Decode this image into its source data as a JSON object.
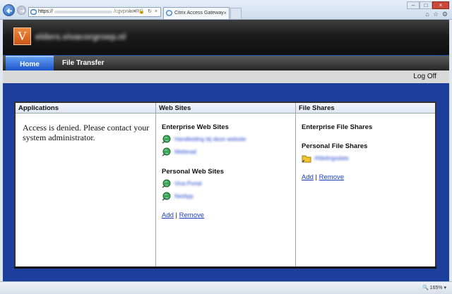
{
  "browser": {
    "url_scheme": "https://",
    "url_path": "/cgvpn/aHR0cDov",
    "tab_title": "Citrix Access Gateway",
    "address_buttons": "⌕ ▾ 🔒 ↻ ×",
    "window_buttons": {
      "minimize": "–",
      "maximize": "□",
      "close": "×"
    },
    "tool_icons": {
      "home": "⌂",
      "favorites": "☆",
      "settings": "⚙"
    },
    "tab_close": "×",
    "zoom": "🔍 165% ▾"
  },
  "site": {
    "logo_letter": "V",
    "title": "elders.vivacorgroep.nl"
  },
  "menu": {
    "home": "Home",
    "file_transfer": "File Transfer",
    "log_off": "Log Off"
  },
  "applications": {
    "header": "Applications",
    "message": "Access is denied. Please contact your system administrator."
  },
  "web_sites": {
    "header": "Web Sites",
    "enterprise_title": "Enterprise Web Sites",
    "enterprise_items": [
      "Handleiding bij deze website",
      "Webmail"
    ],
    "personal_title": "Personal Web Sites",
    "personal_items": [
      "Viva Portal",
      "NetApp"
    ],
    "add": "Add",
    "sep": "|",
    "remove": "Remove"
  },
  "file_shares": {
    "header": "File Shares",
    "enterprise_title": "Enterprise File Shares",
    "personal_title": "Personal File Shares",
    "personal_items": [
      "Afdelingsdata"
    ],
    "add": "Add",
    "sep": "|",
    "remove": "Remove"
  }
}
